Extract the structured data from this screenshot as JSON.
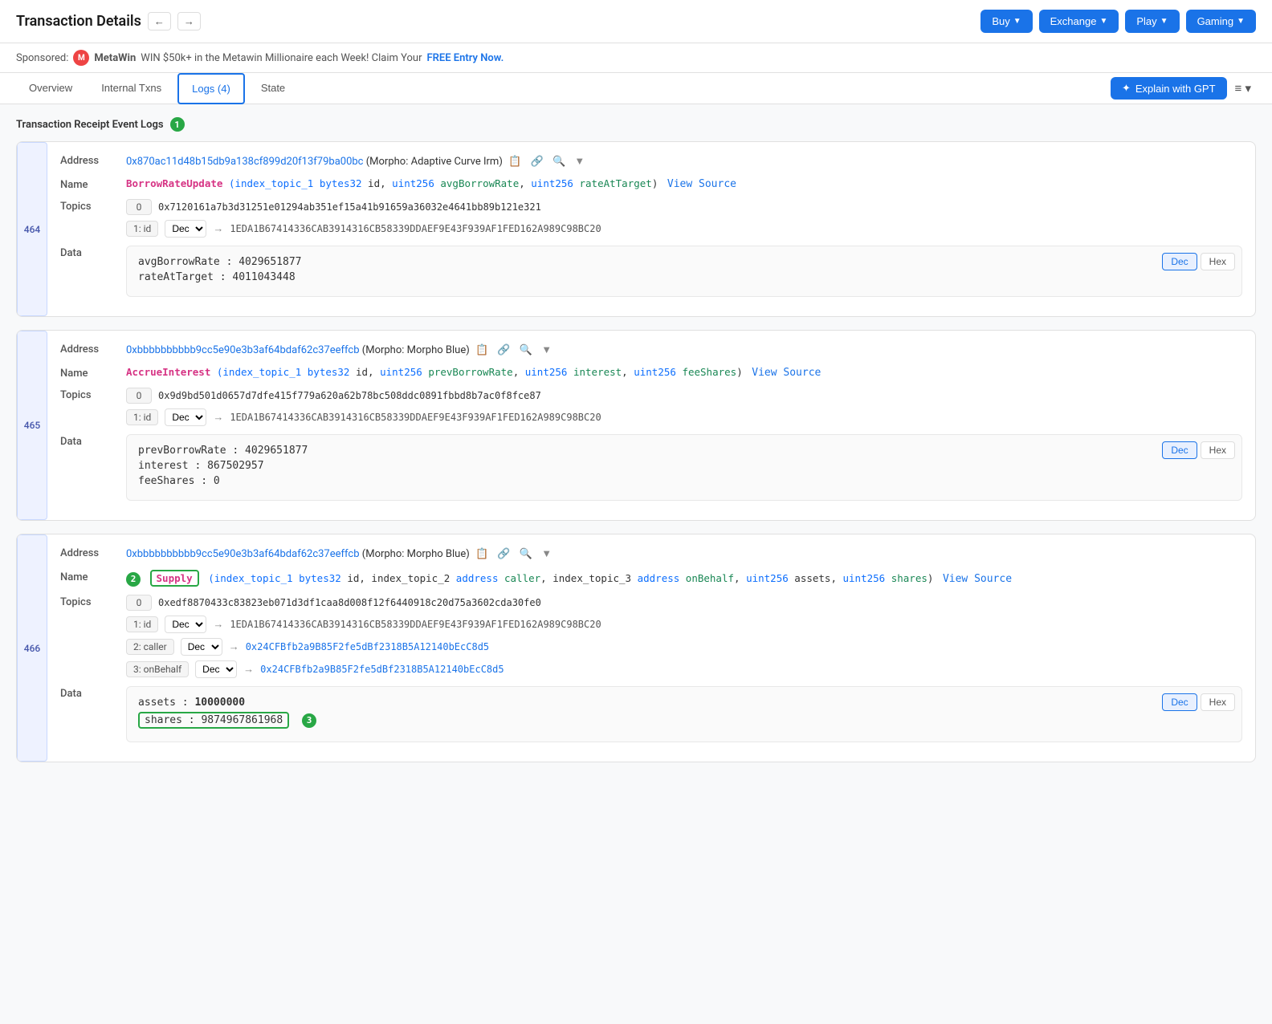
{
  "header": {
    "title": "Transaction Details",
    "nav_buttons": [
      "Buy",
      "Exchange",
      "Play",
      "Gaming"
    ]
  },
  "sponsor": {
    "label": "Sponsored:",
    "name": "MetaWin",
    "text": "WIN $50k+ in the Metawin Millionaire each Week! Claim Your",
    "link_text": "FREE Entry Now.",
    "link_url": "#"
  },
  "tabs": [
    {
      "label": "Overview",
      "active": false
    },
    {
      "label": "Internal Txns",
      "active": false
    },
    {
      "label": "Logs (4)",
      "active": true
    },
    {
      "label": "State",
      "active": false
    }
  ],
  "explain_btn": "Explain with GPT",
  "section_title": "Transaction Receipt Event Logs",
  "section_badge": "1",
  "logs": [
    {
      "number": "464",
      "address": "0x870ac11d48b15db9a138cf899d20f13f79ba00bc",
      "address_label": "(Morpho: Adaptive Curve Irm)",
      "name_prefix": "BorrowRateUpdate",
      "name_params": "(index_topic_1 bytes32 id, uint256 avgBorrowRate, uint256 rateAtTarget)",
      "view_source": "View Source",
      "topics": [
        {
          "index": "0",
          "hash": "0x7120161a7b3d31251e01294ab351ef15a41b91659a36032e4641bb89b121e321",
          "has_decoded": false
        },
        {
          "index": "1: id",
          "dec_label": "Dec",
          "arrow": "→",
          "decoded": "1EDA1B67414336CAB3914316CB58339DDAEF9E43F939AF1FED162A989C98BC20",
          "has_decoded": true
        }
      ],
      "data": [
        {
          "key": "avgBorrowRate",
          "value": "4029651877"
        },
        {
          "key": "rateAtTarget",
          "value": "4011043448"
        }
      ]
    },
    {
      "number": "465",
      "address": "0xbbbbbbbbbb9cc5e90e3b3af64bdaf62c37eeffcb",
      "address_label": "(Morpho: Morpho Blue)",
      "name_prefix": "AccrueInterest",
      "name_params": "(index_topic_1 bytes32 id, uint256 prevBorrowRate, uint256 interest, uint256 feeShares)",
      "view_source": "View Source",
      "topics": [
        {
          "index": "0",
          "hash": "0x9d9bd501d0657d7dfe415f779a620a62b78bc508ddc0891fbbd8b7ac0f8fce87",
          "has_decoded": false
        },
        {
          "index": "1: id",
          "dec_label": "Dec",
          "arrow": "→",
          "decoded": "1EDA1B67414336CAB3914316CB58339DDAEF9E43F939AF1FED162A989C98BC20",
          "has_decoded": true
        }
      ],
      "data": [
        {
          "key": "prevBorrowRate",
          "value": "4029651877"
        },
        {
          "key": "interest",
          "value": "867502957"
        },
        {
          "key": "feeShares",
          "value": "0"
        }
      ]
    },
    {
      "number": "466",
      "address": "0xbbbbbbbbbb9cc5e90e3b3af64bdaf62c37eeffcb",
      "address_label": "(Morpho: Morpho Blue)",
      "name_step_badge": "2",
      "name_prefix": "Supply",
      "name_params": "(index_topic_1 bytes32 id, index_topic_2 address caller, index_topic_3 address onBehalf, uint256 assets, uint256 shares)",
      "view_source": "View Source",
      "topics": [
        {
          "index": "0",
          "hash": "0xedf8870433c83823eb071d3df1caa8d008f12f6440918c20d75a3602cda30fe0",
          "has_decoded": false
        },
        {
          "index": "1: id",
          "dec_label": "Dec",
          "arrow": "→",
          "decoded": "1EDA1B67414336CAB3914316CB58339DDAEF9E43F939AF1FED162A989C98BC20",
          "has_decoded": true
        },
        {
          "index": "2: caller",
          "dec_label": "Dec",
          "arrow": "→",
          "decoded_link": "0x24CFBfb2a9B85F2fe5dBf2318B5A12140bEcC8d5",
          "has_link": true
        },
        {
          "index": "3: onBehalf",
          "dec_label": "Dec",
          "arrow": "→",
          "decoded_link": "0x24CFBfb2a9B85F2fe5dBf2318B5A12140bEcC8d5",
          "has_link": true
        }
      ],
      "data": [
        {
          "key": "assets",
          "value": "10000000",
          "bold": true
        },
        {
          "key": "shares",
          "value": "9874967861968",
          "highlight": true
        }
      ],
      "data_badge": "3"
    }
  ]
}
